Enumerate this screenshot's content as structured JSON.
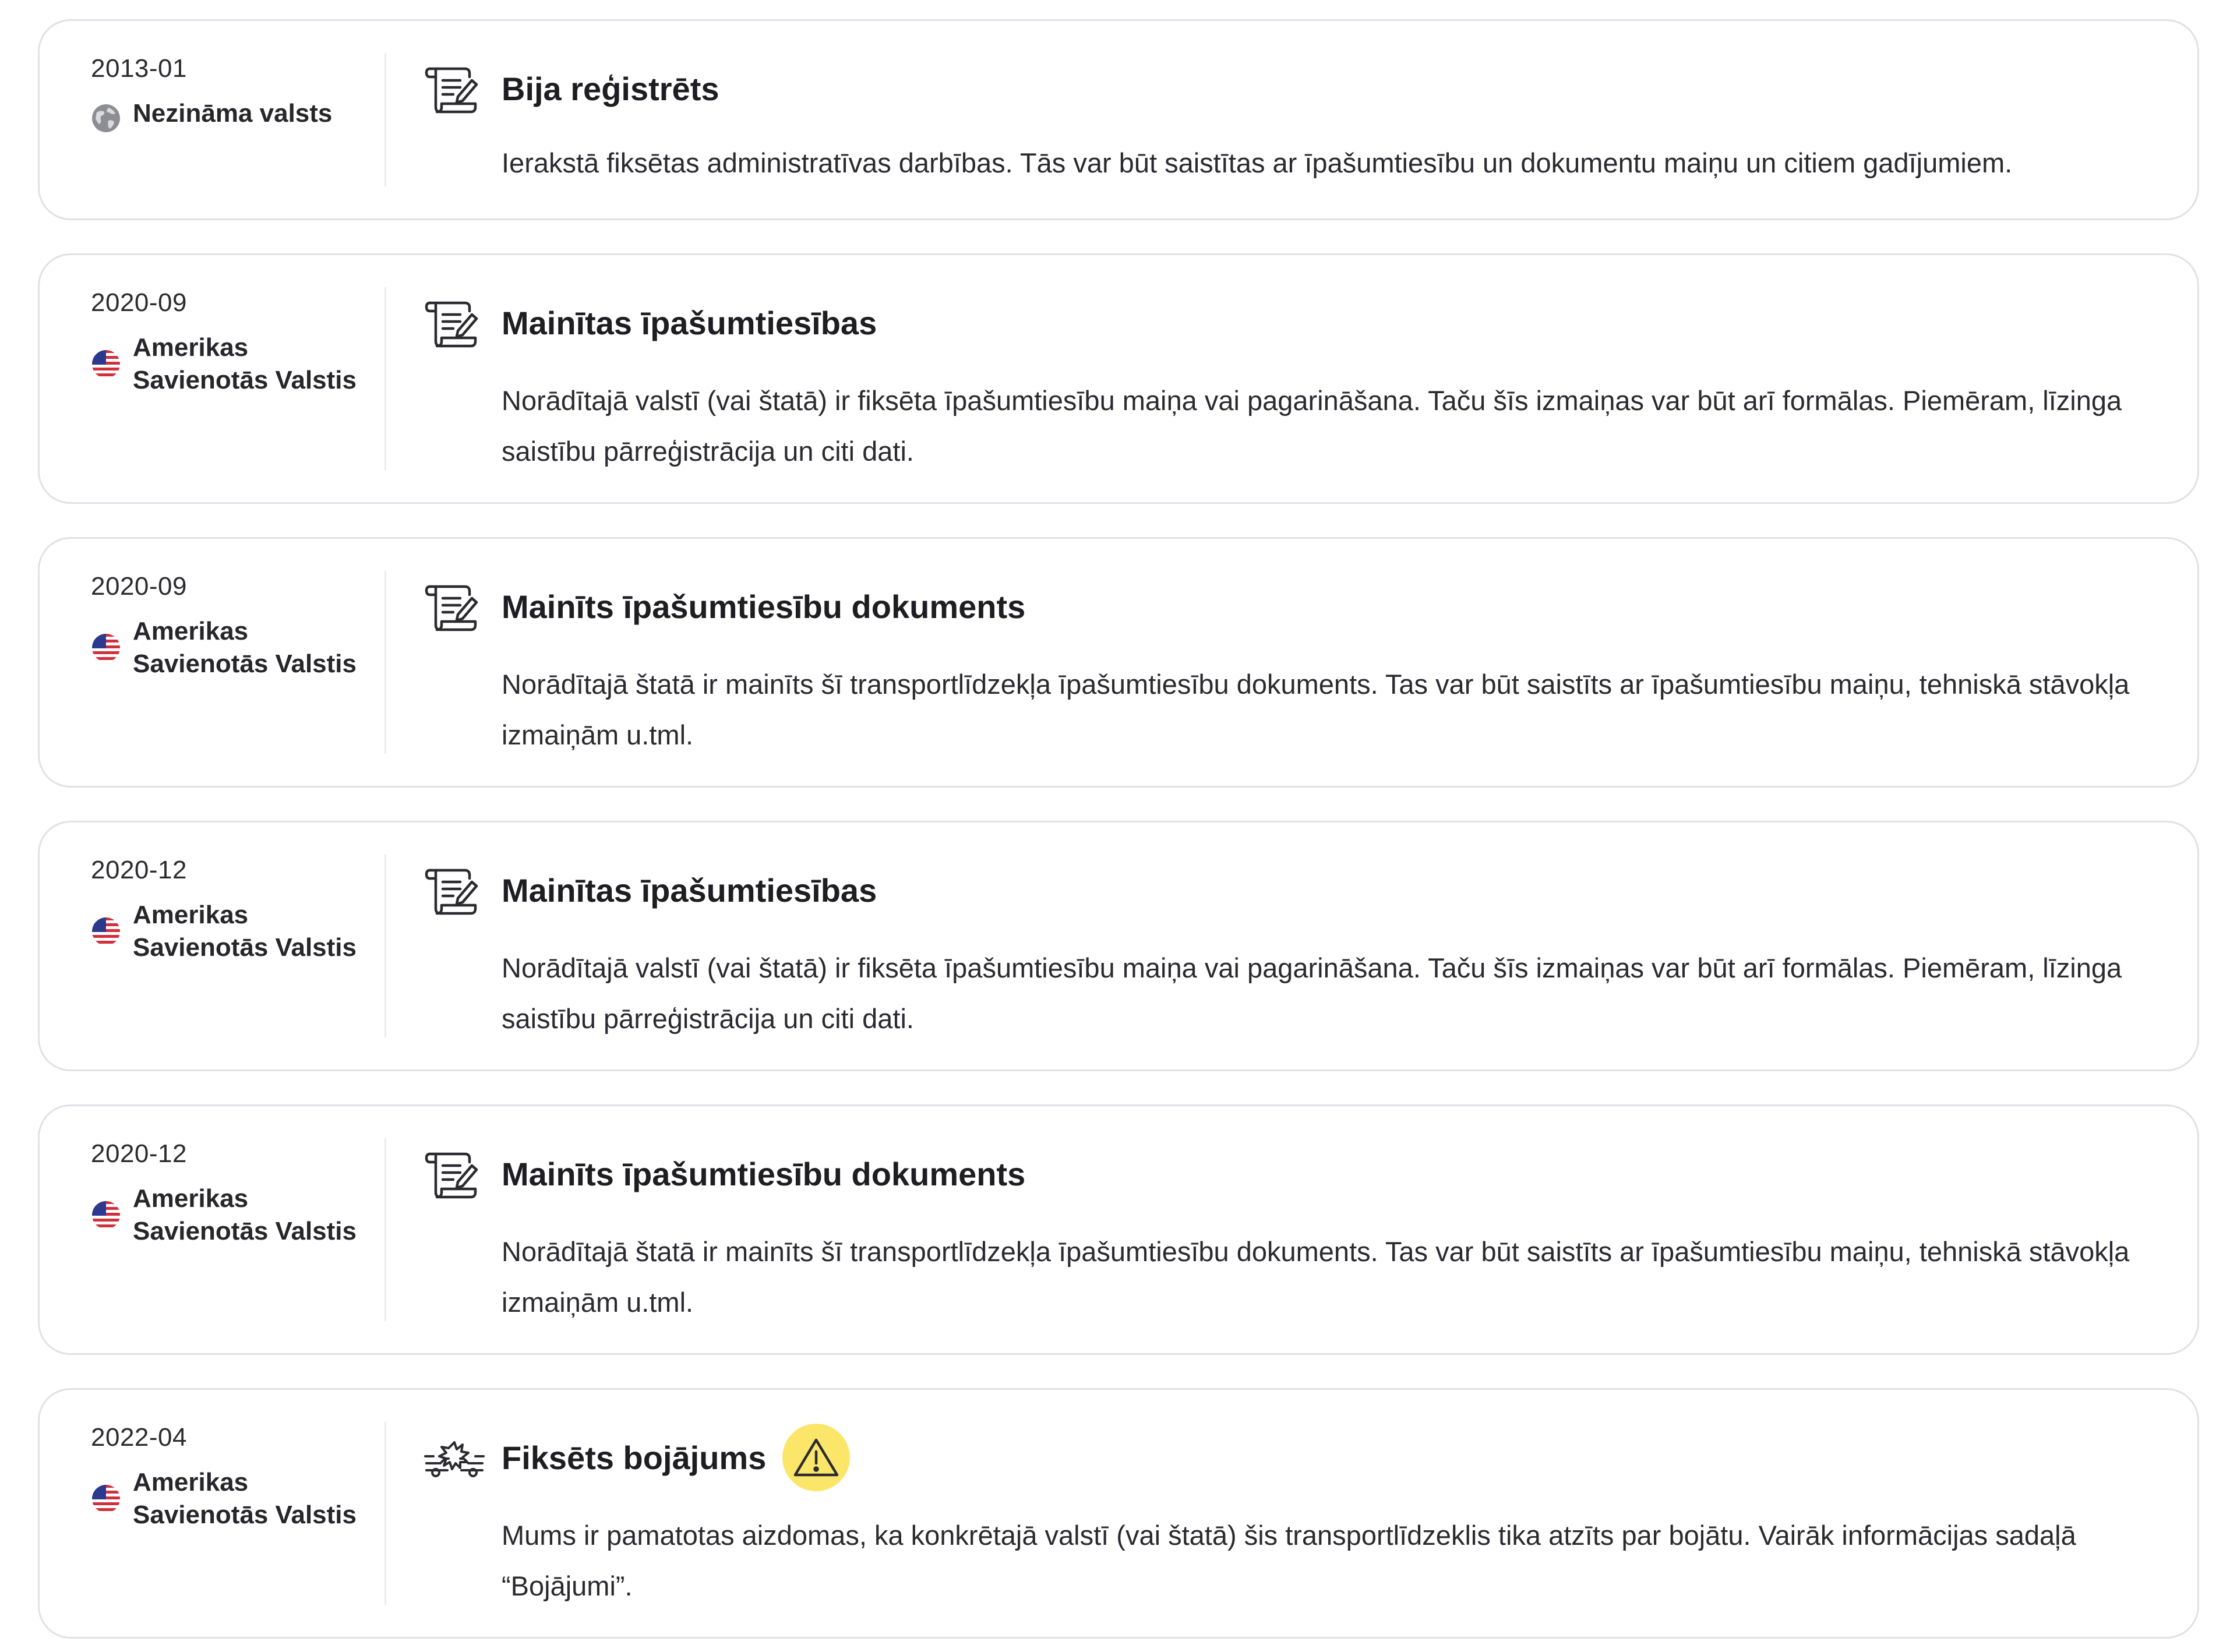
{
  "events": [
    {
      "date": "2013-01",
      "country": "Nezināma valsts",
      "country_icon": "globe-icon",
      "event_icon": "document-scroll-icon",
      "title": "Bija reģistrēts",
      "description": "Ierakstā fiksētas administratīvas darbības. Tās var būt saistītas ar īpašumtiesību un dokumentu maiņu un citiem gadījumiem."
    },
    {
      "date": "2020-09",
      "country": "Amerikas Savienotās Valstis",
      "country_icon": "us-flag-icon",
      "event_icon": "document-scroll-icon",
      "title": "Mainītas īpašumtiesības",
      "description": "Norādītajā valstī (vai štatā) ir fiksēta īpašumtiesību maiņa vai pagarināšana. Taču šīs izmaiņas var būt arī formālas. Piemēram, līzinga saistību pārreģistrācija un citi dati."
    },
    {
      "date": "2020-09",
      "country": "Amerikas Savienotās Valstis",
      "country_icon": "us-flag-icon",
      "event_icon": "document-scroll-icon",
      "title": "Mainīts īpašumtiesību dokuments",
      "description": "Norādītajā štatā ir mainīts šī transportlīdzekļa īpašumtiesību dokuments. Tas var būt saistīts ar īpašumtiesību maiņu, tehniskā stāvokļa izmaiņām u.tml."
    },
    {
      "date": "2020-12",
      "country": "Amerikas Savienotās Valstis",
      "country_icon": "us-flag-icon",
      "event_icon": "document-scroll-icon",
      "title": "Mainītas īpašumtiesības",
      "description": "Norādītajā valstī (vai štatā) ir fiksēta īpašumtiesību maiņa vai pagarināšana. Taču šīs izmaiņas var būt arī formālas. Piemēram, līzinga saistību pārreģistrācija un citi dati."
    },
    {
      "date": "2020-12",
      "country": "Amerikas Savienotās Valstis",
      "country_icon": "us-flag-icon",
      "event_icon": "document-scroll-icon",
      "title": "Mainīts īpašumtiesību dokuments",
      "description": "Norādītajā štatā ir mainīts šī transportlīdzekļa īpašumtiesību dokuments. Tas var būt saistīts ar īpašumtiesību maiņu, tehniskā stāvokļa izmaiņām u.tml."
    },
    {
      "date": "2022-04",
      "country": "Amerikas Savienotās Valstis",
      "country_icon": "us-flag-icon",
      "event_icon": "car-crash-icon",
      "title": "Fiksēts bojājums",
      "warning_icon": "warning-icon",
      "warning_color": "#fbe66a",
      "description": "Mums ir pamatotas aizdomas, ka konkrētajā valstī (vai štatā) šis transportlīdzeklis tika atzīts par bojātu. Vairāk informācijas sadaļā “Bojājumi”."
    }
  ]
}
